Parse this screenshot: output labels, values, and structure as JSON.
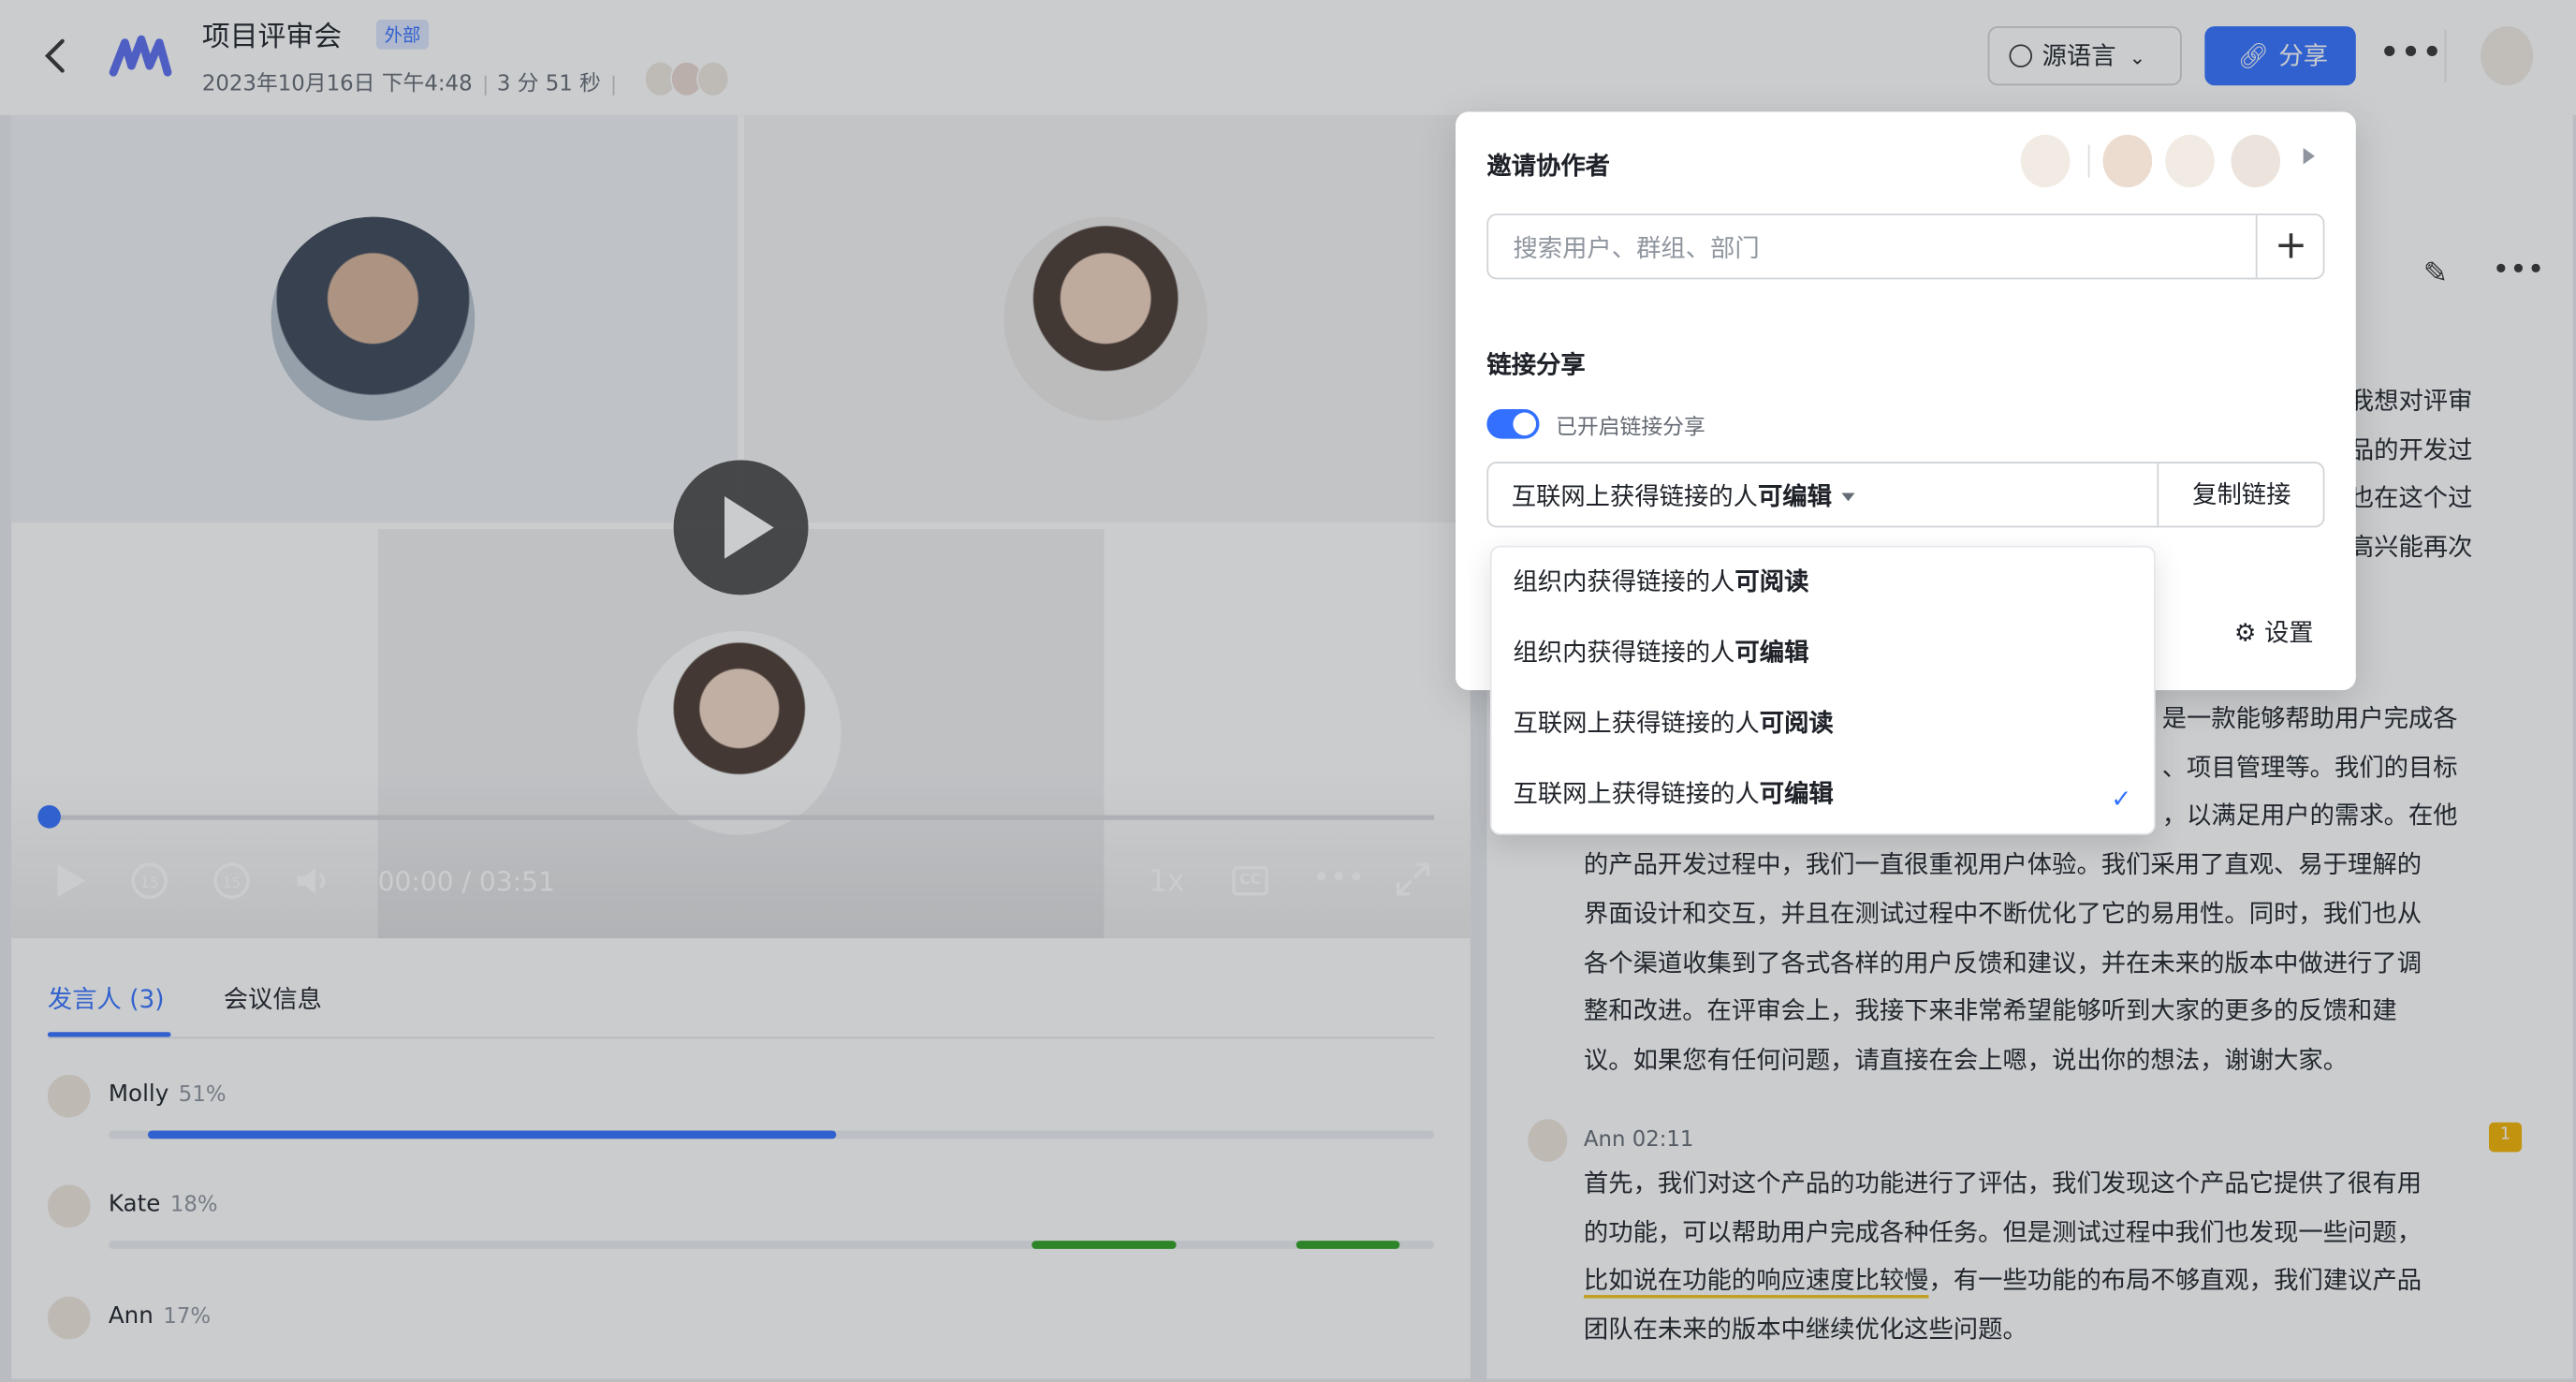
{
  "header": {
    "back_icon": "back-chevron-icon",
    "title": "项目评审会",
    "badge": "外部",
    "date": "2023年10月16日 下午4:48",
    "duration": "3 分 51 秒",
    "lang_button": "源语言",
    "share_button": "分享",
    "accent_color": "#3370ff"
  },
  "video": {
    "time": "00:00 / 03:51",
    "speed": "1x",
    "cc": "CC",
    "progress": 0
  },
  "speakers_panel": {
    "tab_speakers": "发言人 (3)",
    "tab_meeting_info": "会议信息",
    "speakers": [
      {
        "name": "Molly",
        "pct": "51%"
      },
      {
        "name": "Kate",
        "pct": "18%"
      },
      {
        "name": "Ann",
        "pct": "17%"
      }
    ]
  },
  "share_popover": {
    "invite_title": "邀请协作者",
    "search_placeholder": "搜索用户、群组、部门",
    "link_title": "链接分享",
    "toggle_label": "已开启链接分享",
    "selected_prefix": "互联网上获得链接的人",
    "selected_perm": "可编辑",
    "copy_link": "复制链接",
    "settings": "设置",
    "options": [
      {
        "prefix": "组织内获得链接的人",
        "perm": "可阅读"
      },
      {
        "prefix": "组织内获得链接的人",
        "perm": "可编辑"
      },
      {
        "prefix": "互联网上获得链接的人",
        "perm": "可阅读"
      },
      {
        "prefix": "互联网上获得链接的人",
        "perm": "可编辑"
      }
    ]
  },
  "transcript": {
    "block1_visible_lines": [
      "我想对评审",
      "品的开发过",
      "也在这个过",
      "高兴能再次"
    ],
    "block2_lines": [
      "是一款能够帮助用户完成各",
      "、项目管理等。我们的目标",
      "，以满足用户的需求。在他",
      "的产品开发过程中，我们一直很重视用户体验。我们采用了直观、易于理解的",
      "界面设计和交互，并且在测试过程中不断优化了它的易用性。同时，我们也从",
      "各个渠道收集到了各式各样的用户反馈和建议，并在未来的版本中做进行了调",
      "整和改进。在评审会上，我接下来非常希望能够听到大家的更多的反馈和建",
      "议。如果您有任何问题，请直接在会上嗯，说出你的想法，谢谢大家。"
    ],
    "ann_head": "Ann  02:11",
    "comment_count": "1",
    "ann_lines": [
      "首先，我们对这个产品的功能进行了评估，我们发现这个产品它提供了很有用",
      "的功能，可以帮助用户完成各种任务。但是测试过程中我们也发现一些问题，",
      "比如说在功能的响应速度比较慢",
      "，有一些功能的布局不够直观，我们建议产品",
      "团队在未来的版本中继续优化这些问题。"
    ]
  }
}
